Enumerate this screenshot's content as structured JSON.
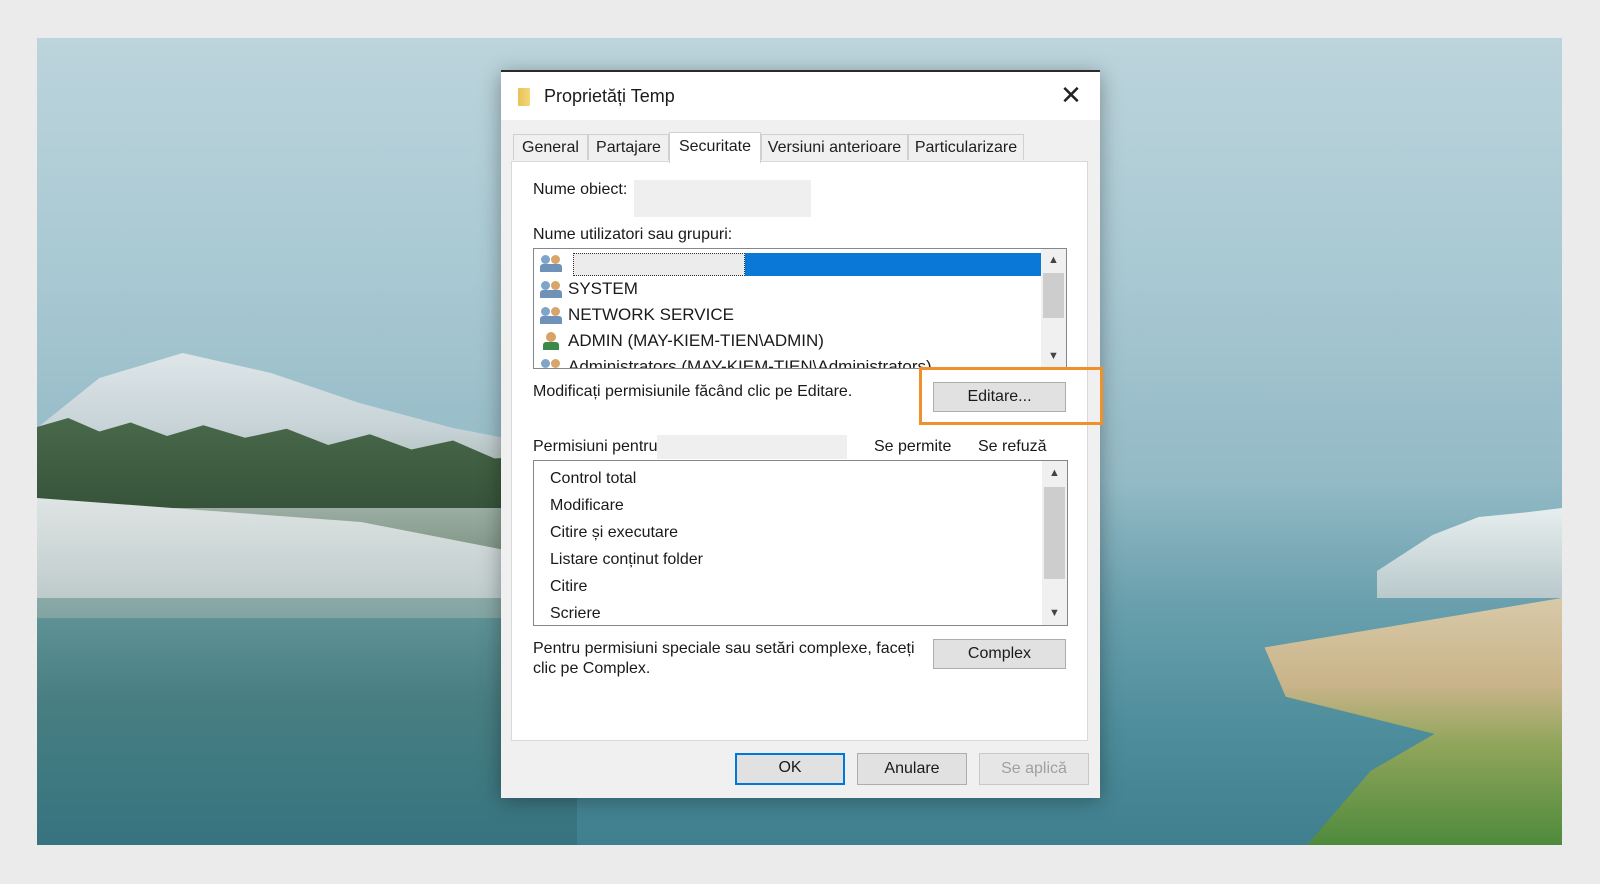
{
  "dialog": {
    "title": "Proprietăți Temp",
    "close_glyph": "✕"
  },
  "tabs": [
    {
      "label": "General",
      "active": false
    },
    {
      "label": "Partajare",
      "active": false
    },
    {
      "label": "Securitate",
      "active": true
    },
    {
      "label": "Versiuni anterioare",
      "active": false
    },
    {
      "label": "Particularizare",
      "active": false
    }
  ],
  "security": {
    "object_name_label": "Nume obiect:",
    "users_label": "Nume utilizatori sau grupuri:",
    "users": [
      {
        "name": "",
        "icon": "group-users-icon",
        "selected": true
      },
      {
        "name": "SYSTEM",
        "icon": "group-users-icon"
      },
      {
        "name": "NETWORK SERVICE",
        "icon": "group-users-icon"
      },
      {
        "name": "ADMIN (MAY-KIEM-TIEN\\ADMIN)",
        "icon": "user-icon"
      },
      {
        "name": "Administrators (MAY-KIEM-TIEN\\Administrators)",
        "icon": "group-users-icon"
      }
    ],
    "edit_hint": "Modificați permisiunile făcând clic pe Editare.",
    "edit_button": "Editare...",
    "permissions_for_label": "Permisiuni pentru",
    "allow_header": "Se permite",
    "deny_header": "Se refuză",
    "permissions": [
      "Control total",
      "Modificare",
      "Citire și executare",
      "Listare conținut folder",
      "Citire",
      "Scriere"
    ],
    "special_hint": "Pentru permisiuni speciale sau setări complexe, faceți clic pe Complex.",
    "complex_button": "Complex"
  },
  "footer": {
    "ok": "OK",
    "cancel": "Anulare",
    "apply": "Se aplică"
  },
  "colors": {
    "selection": "#0a78d7",
    "highlight": "#f0902a"
  }
}
